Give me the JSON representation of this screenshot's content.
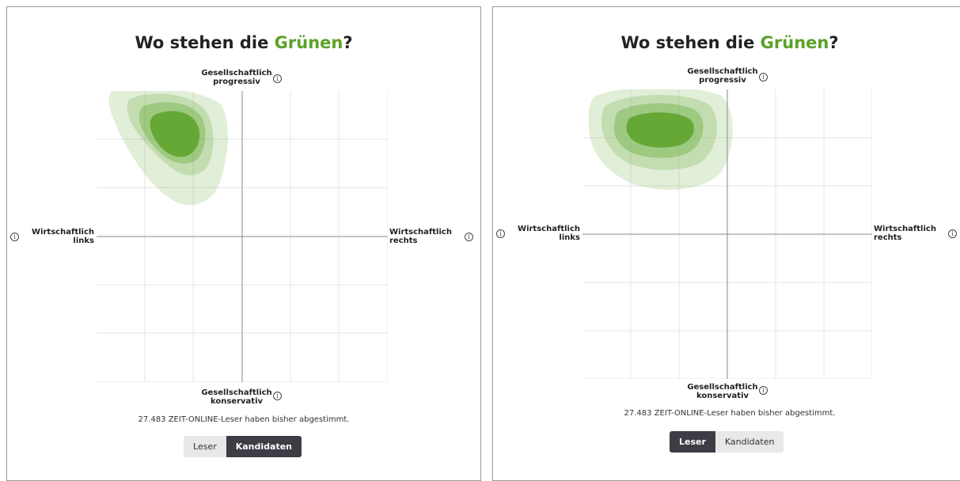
{
  "colors": {
    "accent_green": "#5aa228",
    "active_button": "#3d3d45",
    "inactive_button": "#e8e8e8",
    "grid": "#e6e6e6",
    "axis": "#888888"
  },
  "panels": [
    {
      "title_prefix": "Wo stehen die ",
      "title_highlight": "Grünen",
      "title_suffix": "?",
      "axis_top": [
        "Gesellschaftlich",
        "progressiv"
      ],
      "axis_bottom": [
        "Gesellschaftlich",
        "konservativ"
      ],
      "axis_left": [
        "Wirtschaftlich",
        "links"
      ],
      "axis_right": [
        "Wirtschaftlich",
        "rechts"
      ],
      "info_icon": "info-icon",
      "vote_text": "27.483 ZEIT-ONLINE-Leser haben bisher abgestimmt.",
      "toggle": {
        "reader_label": "Leser",
        "candidates_label": "Kandidaten",
        "selected": "Kandidaten"
      }
    },
    {
      "title_prefix": "Wo stehen die ",
      "title_highlight": "Grünen",
      "title_suffix": "?",
      "axis_top": [
        "Gesellschaftlich",
        "progressiv"
      ],
      "axis_bottom": [
        "Gesellschaftlich",
        "konservativ"
      ],
      "axis_left": [
        "Wirtschaftlich",
        "links"
      ],
      "axis_right": [
        "Wirtschaftlich",
        "rechts"
      ],
      "info_icon": "info-icon",
      "vote_text": "27.483 ZEIT-ONLINE-Leser haben bisher abgestimmt.",
      "toggle": {
        "reader_label": "Leser",
        "candidates_label": "Kandidaten",
        "selected": "Leser"
      }
    }
  ]
}
